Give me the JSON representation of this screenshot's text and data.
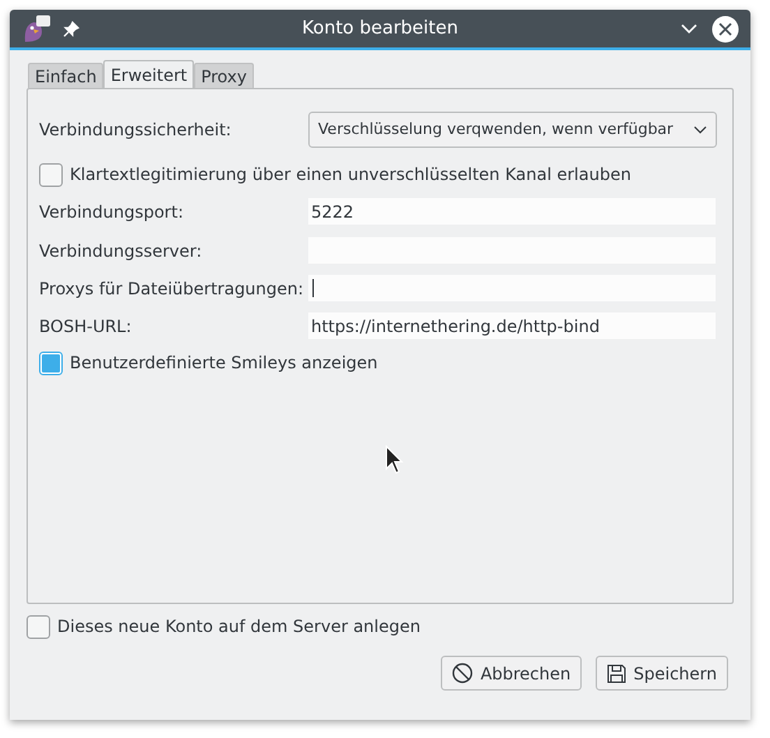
{
  "window": {
    "title": "Konto bearbeiten"
  },
  "tabs": [
    {
      "label": "Einfach",
      "selected": false
    },
    {
      "label": "Erweitert",
      "selected": true
    },
    {
      "label": "Proxy",
      "selected": false
    }
  ],
  "settings": [
    {
      "kind": "select",
      "label": "Verbindungssicherheit:",
      "value": "Verschlüsselung verqwenden, wenn verfügbar"
    },
    {
      "kind": "checkbox",
      "label": "Klartextlegitimierung über einen unverschlüsselten Kanal erlauben",
      "checked": false
    },
    {
      "kind": "text",
      "label": "Verbindungsport:",
      "value": "5222",
      "focused": false
    },
    {
      "kind": "text",
      "label": "Verbindungsserver:",
      "focused": false
    },
    {
      "kind": "text",
      "label": "Proxys für Dateiübertragungen:",
      "focused": true
    },
    {
      "kind": "text",
      "label": "BOSH-URL:",
      "value": "https://internethering.de/http-bind",
      "focused": false
    },
    {
      "kind": "checkbox",
      "label": "Benutzerdefinierte Smileys anzeigen",
      "checked": true
    }
  ],
  "register": {
    "label": "Dieses neue Konto auf dem Server anlegen",
    "checked": false
  },
  "buttons": [
    {
      "kind": "cancel",
      "label": "Abbrechen"
    },
    {
      "kind": "save",
      "label": "Speichern"
    }
  ]
}
